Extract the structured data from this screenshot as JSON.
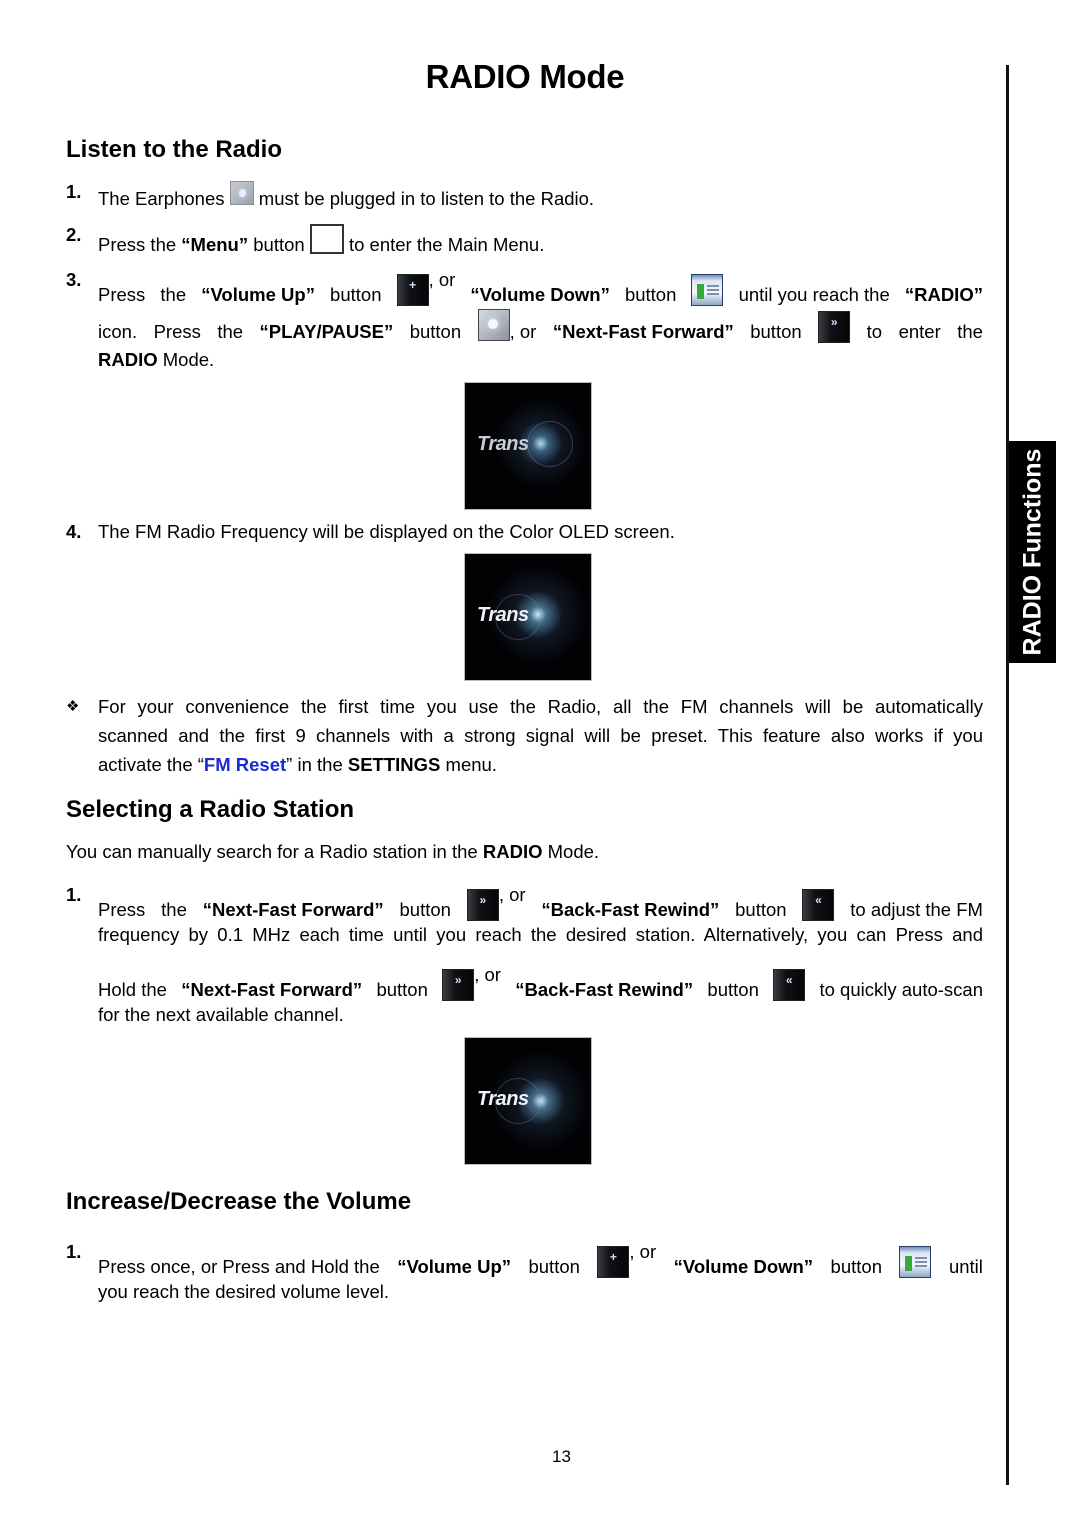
{
  "page": {
    "title": "RADIO Mode",
    "page_number": "13",
    "side_tab": "RADIO Functions"
  },
  "listen": {
    "heading": "Listen to the Radio",
    "step1": {
      "num": "1.",
      "a": "The Earphones",
      "b": "must be plugged in to listen to the Radio."
    },
    "step2": {
      "num": "2.",
      "a": "Press the",
      "menu": "“Menu”",
      "b": "button",
      "c": "to enter the Main Menu."
    },
    "step3": {
      "num": "3.",
      "l1": [
        "Press",
        "the",
        "“Volume Up”",
        "button",
        ", or",
        "“Volume Down”",
        "button",
        "until you reach the",
        "“RADIO”"
      ],
      "l2": [
        "icon.",
        "Press",
        "the",
        "“PLAY/PAUSE”",
        "button",
        ", or",
        "“Next-Fast Forward”",
        "button",
        "to",
        "enter",
        "the"
      ],
      "l3_bold": "RADIO",
      "l3_rest": " Mode."
    },
    "screen_logo": "Trans",
    "step4": {
      "num": "4.",
      "text": "The FM Radio Frequency will be displayed on the Color OLED screen."
    },
    "note": {
      "bullet": "❖",
      "l1": "For your convenience the first time you use the Radio, all the FM channels will be automatically",
      "l2": "scanned and the first 9 channels with a strong signal will be preset. This feature also works if you",
      "l3a": "activate the “",
      "link": "FM Reset",
      "l3b": "” in the ",
      "settings": "SETTINGS",
      "l3c": " menu."
    }
  },
  "select": {
    "heading": "Selecting a Radio Station",
    "intro_a": "You can manually search for a Radio station in the ",
    "intro_bold": "RADIO",
    "intro_b": " Mode.",
    "step1": {
      "num": "1.",
      "l1": [
        "Press",
        "the",
        "“Next-Fast Forward”",
        "button",
        ", or",
        "“Back-Fast Rewind”",
        "button",
        "to adjust the FM"
      ],
      "l2": "frequency by 0.1 MHz each time until you reach the desired station. Alternatively, you can Press and",
      "l3": [
        "Hold the",
        "“Next-Fast Forward”",
        "button",
        ", or",
        "“Back-Fast Rewind”",
        "button",
        "to quickly auto-scan"
      ],
      "l4": "for the next available channel."
    },
    "screen_logo": "Trans"
  },
  "volume": {
    "heading": "Increase/Decrease the Volume",
    "step1": {
      "num": "1.",
      "l1": [
        "Press once, or Press and Hold the",
        "“Volume Up”",
        "button",
        ", or",
        "“Volume Down”",
        "button",
        "until"
      ],
      "l2": "you reach the desired volume level."
    }
  },
  "icons": {
    "earphones": "earphones-icon",
    "menu": "menu-button-icon",
    "volume_up": "volume-up-icon",
    "volume_down": "volume-down-icon",
    "play_pause": "play-pause-icon",
    "next_fast_forward": "fast-forward-icon",
    "back_fast_rewind": "rewind-icon"
  },
  "colors": {
    "link": "#1a2bd6",
    "tab_bg": "#000000",
    "tab_text": "#ffffff"
  }
}
